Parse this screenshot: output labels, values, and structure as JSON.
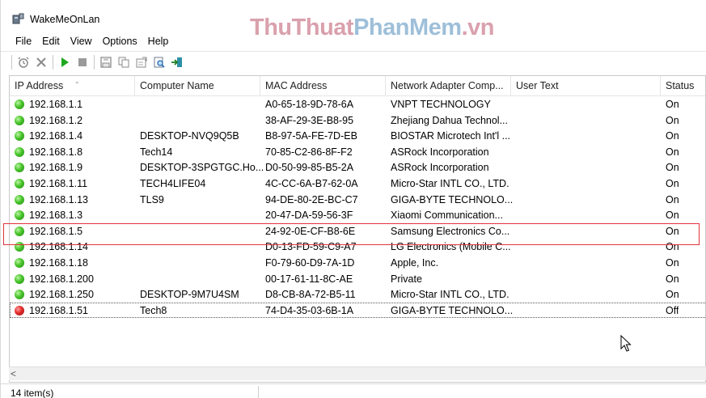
{
  "window": {
    "title": "WakeMeOnLan",
    "watermark_parts": [
      "Thu",
      "Thuat",
      "PhanMem",
      ".vn"
    ]
  },
  "menu": [
    "File",
    "Edit",
    "View",
    "Options",
    "Help"
  ],
  "toolbar_icons": [
    "alarm-icon",
    "delete-icon",
    "play-icon",
    "stop-icon",
    "save-icon",
    "copy-icon",
    "properties-icon",
    "find-icon",
    "exit-icon"
  ],
  "columns": [
    "IP Address",
    "Computer Name",
    "MAC Address",
    "Network Adapter Comp...",
    "User Text",
    "Status"
  ],
  "rows": [
    {
      "ip": "192.168.1.1",
      "name": "",
      "mac": "A0-65-18-9D-78-6A",
      "adapter": "VNPT TECHNOLOGY",
      "user": "",
      "status": "On",
      "state": "on"
    },
    {
      "ip": "192.168.1.2",
      "name": "",
      "mac": "38-AF-29-3E-B8-95",
      "adapter": "Zhejiang Dahua Technol...",
      "user": "",
      "status": "On",
      "state": "on"
    },
    {
      "ip": "192.168.1.4",
      "name": "DESKTOP-NVQ9Q5B",
      "mac": "B8-97-5A-FE-7D-EB",
      "adapter": "BIOSTAR Microtech Int'l ...",
      "user": "",
      "status": "On",
      "state": "on"
    },
    {
      "ip": "192.168.1.8",
      "name": "Tech14",
      "mac": "70-85-C2-86-8F-F2",
      "adapter": "ASRock Incorporation",
      "user": "",
      "status": "On",
      "state": "on"
    },
    {
      "ip": "192.168.1.9",
      "name": "DESKTOP-3SPGTGC.Ho...",
      "mac": "D0-50-99-85-B5-2A",
      "adapter": "ASRock Incorporation",
      "user": "",
      "status": "On",
      "state": "on"
    },
    {
      "ip": "192.168.1.11",
      "name": "TECH4LIFE04",
      "mac": "4C-CC-6A-B7-62-0A",
      "adapter": "Micro-Star INTL CO., LTD.",
      "user": "",
      "status": "On",
      "state": "on"
    },
    {
      "ip": "192.168.1.13",
      "name": "TLS9",
      "mac": "94-DE-80-2E-BC-C7",
      "adapter": "GIGA-BYTE TECHNOLO...",
      "user": "",
      "status": "On",
      "state": "on"
    },
    {
      "ip": "192.168.1.3",
      "name": "",
      "mac": "20-47-DA-59-56-3F",
      "adapter": "Xiaomi Communication...",
      "user": "",
      "status": "On",
      "state": "on"
    },
    {
      "ip": "192.168.1.5",
      "name": "",
      "mac": "24-92-0E-CF-B8-6E",
      "adapter": "Samsung Electronics Co...",
      "user": "",
      "status": "On",
      "state": "on"
    },
    {
      "ip": "192.168.1.14",
      "name": "",
      "mac": "D0-13-FD-59-C9-A7",
      "adapter": "LG Electronics (Mobile C...",
      "user": "",
      "status": "On",
      "state": "on"
    },
    {
      "ip": "192.168.1.18",
      "name": "",
      "mac": "F0-79-60-D9-7A-1D",
      "adapter": "Apple, Inc.",
      "user": "",
      "status": "On",
      "state": "on"
    },
    {
      "ip": "192.168.1.200",
      "name": "",
      "mac": "00-17-61-11-8C-AE",
      "adapter": "Private",
      "user": "",
      "status": "On",
      "state": "on"
    },
    {
      "ip": "192.168.1.250",
      "name": "DESKTOP-9M7U4SM",
      "mac": "D8-CB-8A-72-B5-11",
      "adapter": "Micro-Star INTL CO., LTD.",
      "user": "",
      "status": "On",
      "state": "on"
    },
    {
      "ip": "192.168.1.51",
      "name": "Tech8",
      "mac": "74-D4-35-03-6B-1A",
      "adapter": "GIGA-BYTE TECHNOLO...",
      "user": "",
      "status": "Off",
      "state": "off",
      "selected": true
    }
  ],
  "status_bar": {
    "count_text": "14 item(s)"
  },
  "colors": {
    "on": "#48c42a",
    "off": "#e22a2a",
    "highlight_box": "#e0333a"
  }
}
